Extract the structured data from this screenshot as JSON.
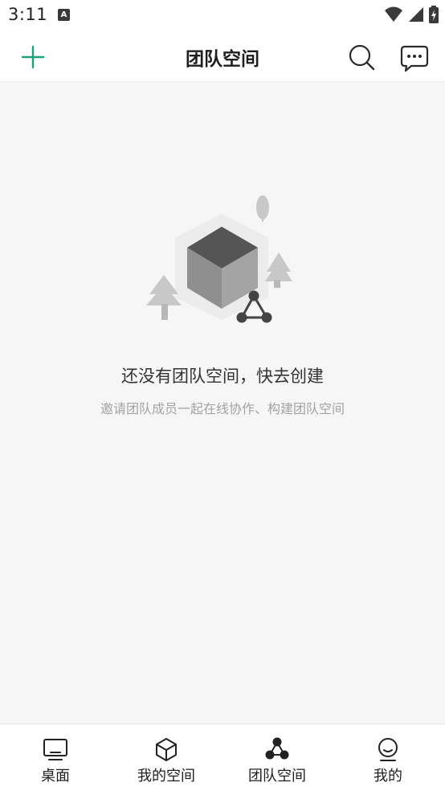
{
  "status_bar": {
    "time": "3:11",
    "app_icon_letter": "A"
  },
  "header": {
    "title": "团队空间"
  },
  "empty_state": {
    "title": "还没有团队空间，快去创建",
    "subtitle": "邀请团队成员一起在线协作、构建团队空间"
  },
  "bottom_nav": {
    "items": [
      {
        "label": "桌面",
        "icon": "desktop-icon",
        "active": false
      },
      {
        "label": "我的空间",
        "icon": "cube-icon",
        "active": false
      },
      {
        "label": "团队空间",
        "icon": "team-icon",
        "active": true
      },
      {
        "label": "我的",
        "icon": "profile-icon",
        "active": false
      }
    ]
  },
  "colors": {
    "accent": "#1aa37a",
    "text": "#1e1e1e",
    "muted": "#a3a3a3",
    "background": "#f6f6f6"
  }
}
